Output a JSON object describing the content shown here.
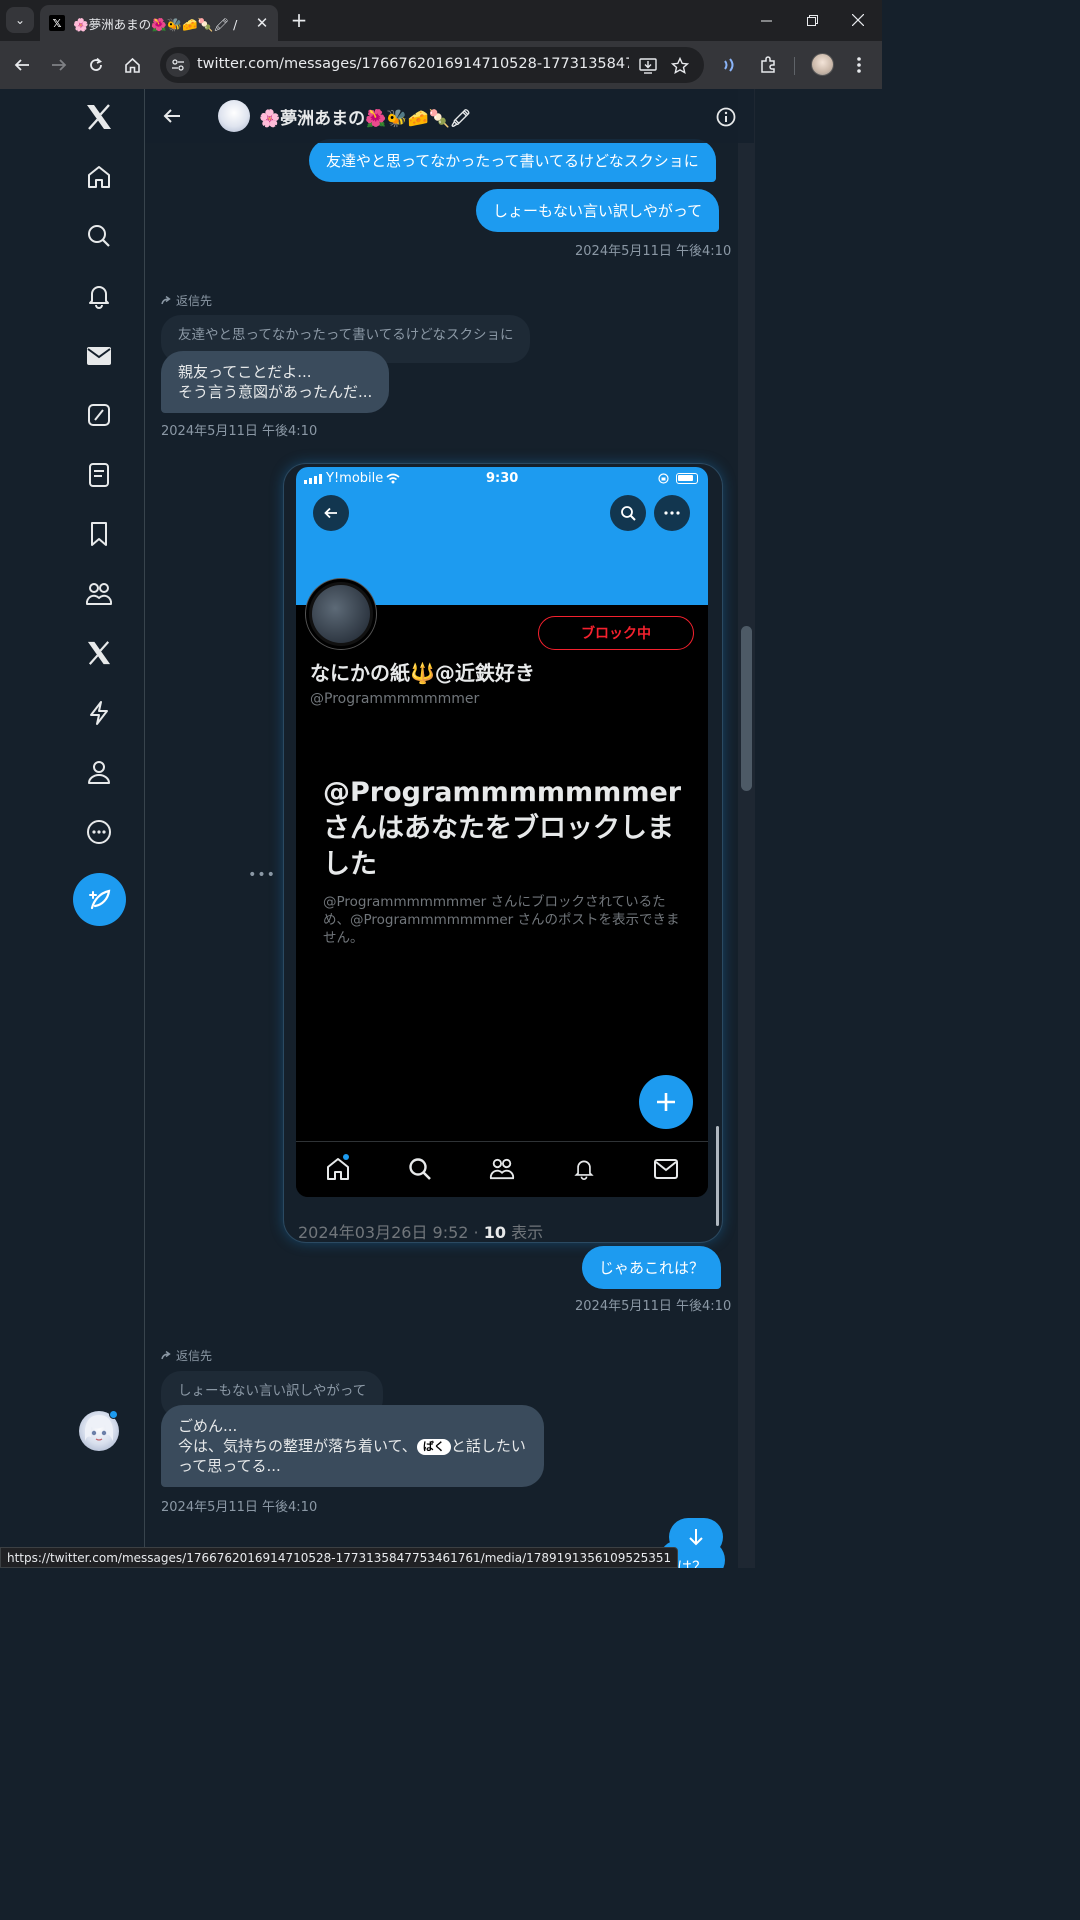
{
  "browser": {
    "tab_title": "🌸夢洲あまの🌺🐝🧀🍡🖍 / X",
    "url": "twitter.com/messages/1766762016914710528-1773135847753461...",
    "status_url": "https://twitter.com/messages/1766762016914710528-1773135847753461761/media/1789191356109525351"
  },
  "header": {
    "name": "🌸夢洲あまの🌺🐝🧀🍡🖍"
  },
  "messages": {
    "out1": "友達やと思ってなかったって書いてるけどなスクショに",
    "out2": "しょーもない言い訳しやがって",
    "ts1": "2024年5月11日 午後4:10",
    "reply_label": "返信先",
    "quote1": "友達やと思ってなかったって書いてるけどなスクショに",
    "in1_line1": "親友ってことだよ...",
    "in1_line2": "そう言う意図があったんだ...",
    "ts2": "2024年5月11日 午後4:10",
    "out3": "じゃあこれは？",
    "ts3": "2024年5月11日 午後4:10",
    "reply_label2": "返信先",
    "quote2": "しょーもない言い訳しやがって",
    "in2_line1": "ごめん...",
    "in2_line2a": "今は、気持ちの整理が落ち着いて、",
    "in2_badge": "ばく",
    "in2_line2b": "と話したい",
    "in2_line3": "って思ってる...",
    "ts4": "2024年5月11日 午後4:10",
    "partial": "は？"
  },
  "media": {
    "carrier": "Y!mobile",
    "time": "9:30",
    "blocked_button": "ブロック中",
    "profile_name": "なにかの紙🔱@近鉄好き",
    "profile_handle": "@Programmmmmmmer",
    "blocked_title": "@Programmmmmmmer さんはあなたをブロックしました",
    "blocked_sub": "@Programmmmmmmer さんにブロックされているため、@Programmmmmmmer さんのポストを表示できません。",
    "footer_date": "2024年03月26日 9:52 · ",
    "footer_views": "10",
    "footer_views_label": " 表示"
  }
}
